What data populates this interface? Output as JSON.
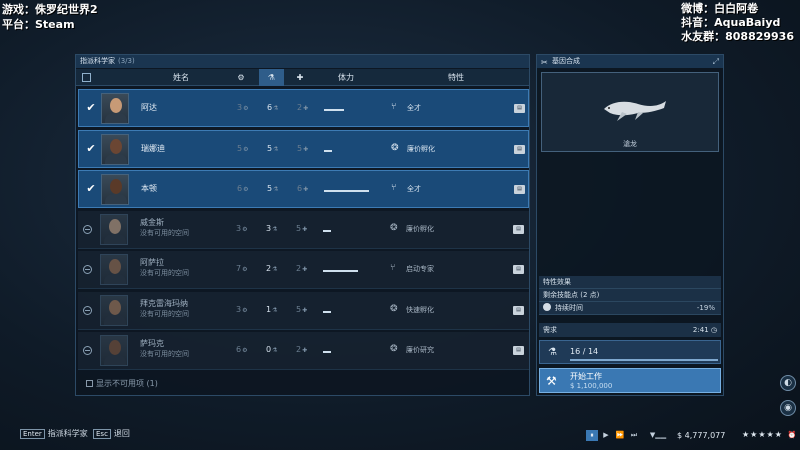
{
  "overlay": {
    "game_line": "游戏：侏罗纪世界2",
    "platform_line": "平台：Steam",
    "weibo_line": "微博：白白阿卷",
    "douyin_line": "抖音：AquaBaiyd",
    "qq_line": "水友群：808829936"
  },
  "panel": {
    "title": "指派科学家",
    "count": "(3/3)",
    "columns": {
      "name": "姓名",
      "stamina": "体力",
      "trait": "特性"
    },
    "hide_unavailable": "显示不可用项 (1)"
  },
  "scientists": [
    {
      "name": "阿达",
      "sub": "",
      "s1": "3",
      "s2": "6",
      "s3": "2",
      "bar": 0.4,
      "trait": "全才",
      "trait_icon": "dna-icon",
      "selected": true,
      "skin": "#c79a76"
    },
    {
      "name": "瑞娜迪",
      "sub": "",
      "s1": "5",
      "s2": "5",
      "s3": "5",
      "bar": 0.15,
      "trait": "廉价孵化",
      "trait_icon": "egg-icon",
      "selected": true,
      "skin": "#6b4633"
    },
    {
      "name": "本顿",
      "sub": "",
      "s1": "6",
      "s2": "5",
      "s3": "6",
      "bar": 0.9,
      "trait": "全才",
      "trait_icon": "dna-icon",
      "selected": true,
      "skin": "#5a3a28"
    },
    {
      "name": "威金斯",
      "sub": "没有可用的空间",
      "s1": "3",
      "s2": "3",
      "s3": "5",
      "bar": 0.15,
      "trait": "廉价孵化",
      "trait_icon": "egg-icon",
      "selected": false,
      "skin": "#d9b493"
    },
    {
      "name": "阿萨拉",
      "sub": "没有可用的空间",
      "s1": "7",
      "s2": "2",
      "s3": "2",
      "bar": 0.7,
      "trait": "启动专家",
      "trait_icon": "dna-icon",
      "selected": false,
      "skin": "#a97a5a"
    },
    {
      "name": "拜克雷海玛纳",
      "sub": "没有可用的空间",
      "s1": "3",
      "s2": "1",
      "s3": "5",
      "bar": 0.15,
      "trait": "快速孵化",
      "trait_icon": "egg-icon",
      "selected": false,
      "skin": "#b88763"
    },
    {
      "name": "萨玛克",
      "sub": "没有可用的空间",
      "s1": "6",
      "s2": "0",
      "s3": "2",
      "bar": 0.15,
      "trait": "廉价研究",
      "trait_icon": "egg-icon",
      "selected": false,
      "skin": "#8a5c40"
    }
  ],
  "right": {
    "title": "基因合成",
    "dino_name": "滄龙",
    "trait_effect": "特性效果",
    "skill_points": "剩余技能点 (2 点)",
    "duration_label": "持续时间",
    "duration_val": "-19%",
    "requirements": "需求",
    "req_time": "2:41",
    "req_progress": "16 / 14",
    "start_label": "开始工作",
    "start_cost": "$ 1,100,000"
  },
  "bottom": {
    "enter_key": "Enter",
    "enter_label": "指派科学家",
    "esc_key": "Esc",
    "esc_label": "退回",
    "money": "$ 4,777,077",
    "stars": "★★★★★"
  },
  "colors": {
    "accent": "#3a78b3",
    "selected_row": "#1a4a78",
    "panel_bg": "#0c1621"
  }
}
